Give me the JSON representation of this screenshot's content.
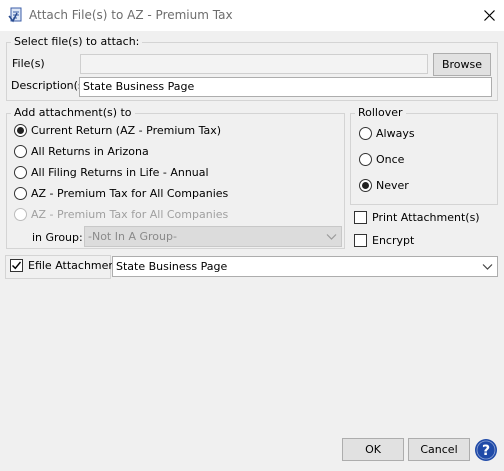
{
  "window": {
    "title": "Attach File(s) to AZ - Premium Tax",
    "app_icon": "document-attach-icon",
    "close_icon": "close-icon"
  },
  "select_files": {
    "group_label": "Select file(s) to attach:",
    "files_label": "File(s)",
    "files_value": "",
    "browse_label": "Browse",
    "description_label": "Description(s)",
    "description_value": "State Business Page"
  },
  "add_to": {
    "group_label": "Add attachment(s) to",
    "options": [
      {
        "label": "Current Return (AZ - Premium Tax)",
        "checked": true,
        "enabled": true
      },
      {
        "label": "All Returns in Arizona",
        "checked": false,
        "enabled": true
      },
      {
        "label": "All Filing Returns in Life - Annual",
        "checked": false,
        "enabled": true
      },
      {
        "label": "AZ - Premium Tax for All Companies",
        "checked": false,
        "enabled": true
      },
      {
        "label": "AZ - Premium Tax for All Companies",
        "checked": false,
        "enabled": false
      }
    ],
    "group_select_label": "in Group:",
    "group_select_value": "-Not In A Group-"
  },
  "rollover": {
    "group_label": "Rollover",
    "options": [
      {
        "label": "Always",
        "checked": false
      },
      {
        "label": "Once",
        "checked": false
      },
      {
        "label": "Never",
        "checked": true
      }
    ]
  },
  "options": {
    "print_label": "Print Attachment(s)",
    "print_checked": false,
    "encrypt_label": "Encrypt",
    "encrypt_checked": false
  },
  "efile": {
    "label": "Efile Attachment",
    "checked": true,
    "value": "State Business Page"
  },
  "footer": {
    "ok_label": "OK",
    "cancel_label": "Cancel",
    "help_icon": "help-icon",
    "help_color": "#1f4aa8"
  }
}
